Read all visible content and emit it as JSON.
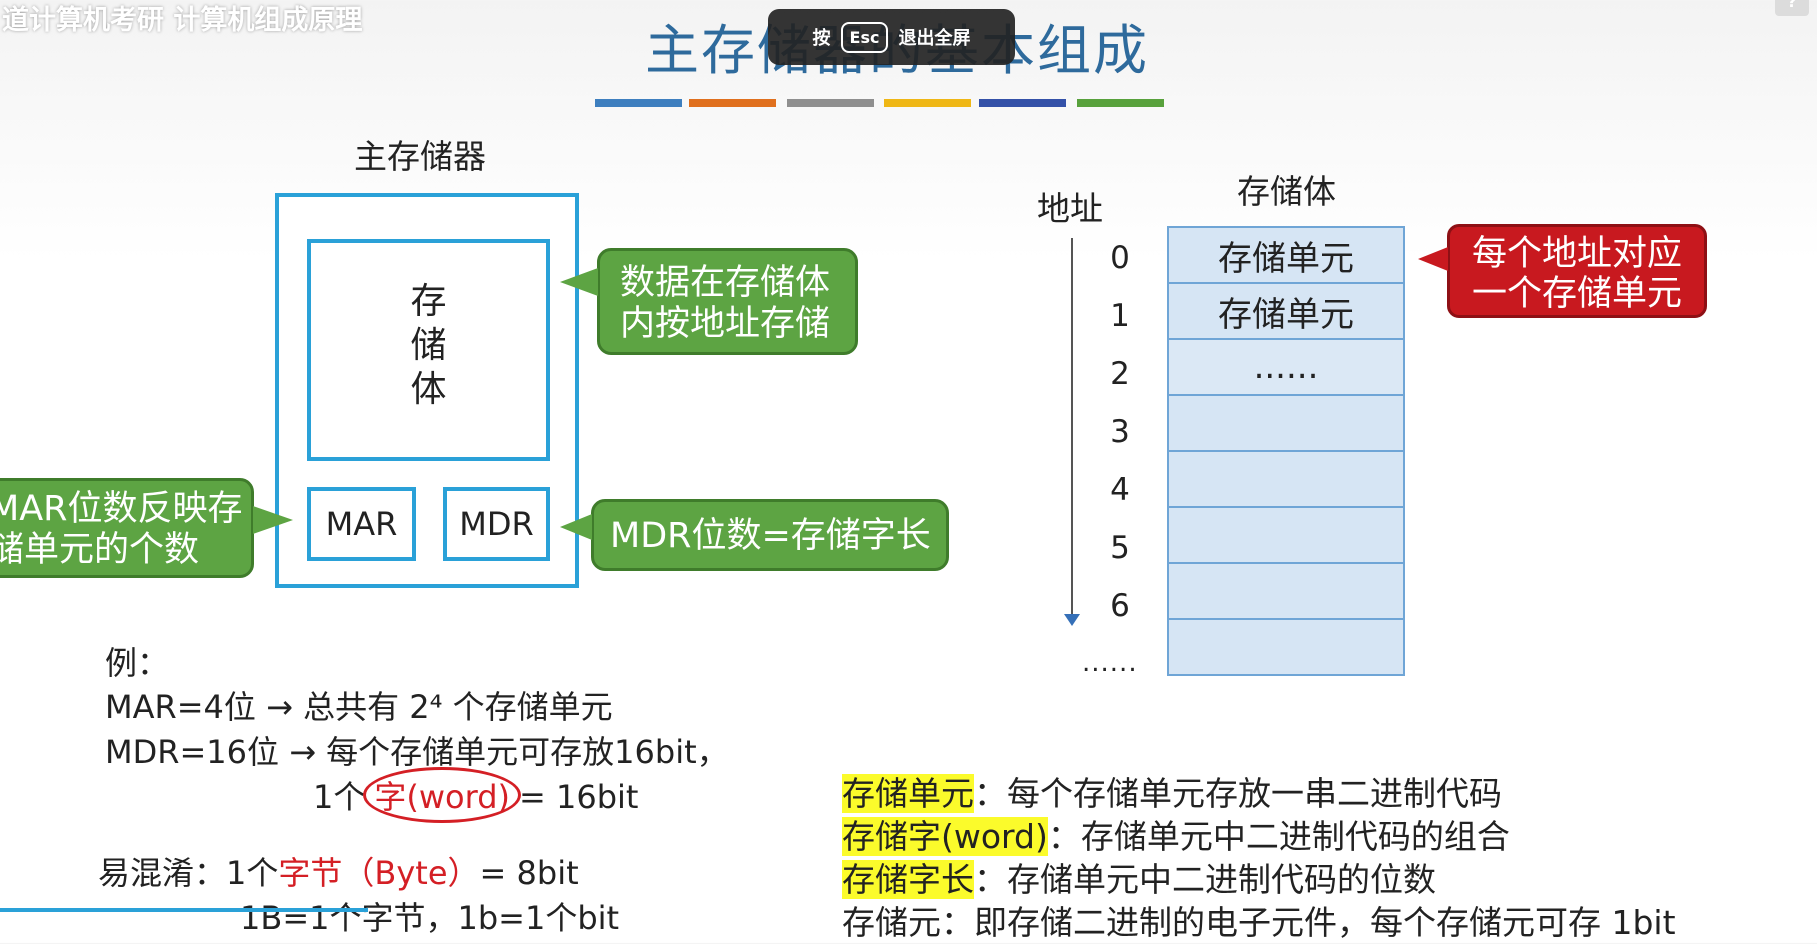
{
  "video": {
    "title": "道计算机考研 计算机组成原理",
    "exit_key": "Esc",
    "exit_prefix": "按",
    "exit_text": "退出全屏",
    "help": "?"
  },
  "slide": {
    "title": "主存储器的基本组成",
    "bar_colors": [
      "#3e7fbf",
      "#e0701e",
      "#8f8f8f",
      "#efb716",
      "#3451a8",
      "#58a13c"
    ]
  },
  "diagram": {
    "main_memory_label": "主存储器",
    "storage_body": [
      "存",
      "储",
      "体"
    ],
    "mar": "MAR",
    "mdr": "MDR",
    "callout_data": [
      "数据在存储体",
      "内按地址存储"
    ],
    "callout_mar": [
      "MAR位数反映存",
      "储单元的个数"
    ],
    "callout_mdr": "MDR位数=存储字长"
  },
  "address_table": {
    "address_label": "地址",
    "body_label": "存储体",
    "addresses": [
      "0",
      "1",
      "2",
      "3",
      "4",
      "5",
      "6",
      "......"
    ],
    "cells": [
      "存储单元",
      "存储单元",
      "......",
      "",
      "",
      "",
      "",
      ""
    ],
    "callout": [
      "每个地址对应",
      "一个存储单元"
    ]
  },
  "example": {
    "heading": "例：",
    "line1": "MAR=4位 → 总共有 2⁴ 个存储单元",
    "line2": "MDR=16位 → 每个存储单元可存放16bit，",
    "line3_pre": "1个",
    "line3_word": "字(word)",
    "line3_post": "= 16bit",
    "confuse_label": "易混淆：",
    "confuse_pre": "1个",
    "confuse_byte": "字节（Byte）",
    "confuse_post": "= 8bit",
    "line5": "1B=1个字节，1b=1个bit"
  },
  "definitions": [
    {
      "term": "存储单元",
      "desc": "：每个存储单元存放一串二进制代码",
      "highlight": true
    },
    {
      "term": "存储字(word)",
      "desc": "：存储单元中二进制代码的组合",
      "highlight": true
    },
    {
      "term": "存储字长",
      "desc": "：存储单元中二进制代码的位数",
      "highlight": true
    },
    {
      "term": "存储元",
      "desc": "：即存储二进制的电子元件，每个存储元可存 1bit",
      "highlight": false
    }
  ]
}
